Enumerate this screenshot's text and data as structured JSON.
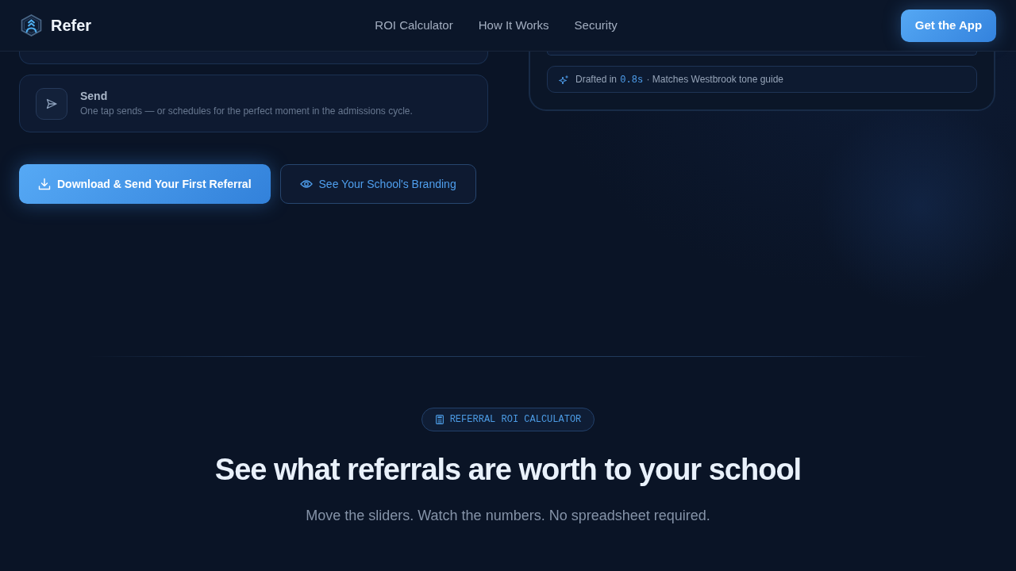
{
  "navbar": {
    "brand": "Refer",
    "links": [
      {
        "label": "ROI Calculator"
      },
      {
        "label": "How It Works"
      },
      {
        "label": "Security"
      }
    ],
    "cta": "Get the App"
  },
  "steps": [
    {
      "title": "Send",
      "description": "One tap sends — or schedules for the perfect moment in the admissions cycle."
    }
  ],
  "actions": [
    {
      "kind": "primary",
      "label": "Download & Send Your First Referral"
    },
    {
      "kind": "secondary",
      "label": "See Your School's Branding"
    }
  ],
  "draft_note": {
    "prefix": "Drafted in",
    "time": "0.8s",
    "suffix": "· Matches Westbrook tone guide"
  },
  "calculator": {
    "badge": "REFERRAL ROI CALCULATOR",
    "title": "See what referrals are worth to your school",
    "subtitle": "Move the sliders. Watch the numbers. No spreadsheet required."
  }
}
